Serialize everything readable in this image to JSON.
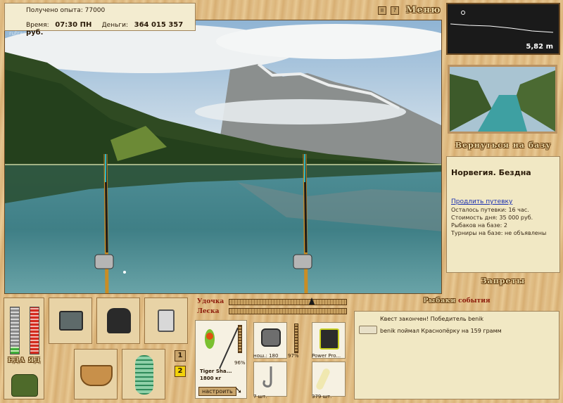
{
  "header": {
    "experience_label": "Получено опыта:",
    "experience_value": "77000",
    "time_label": "Время:",
    "time_value": "07:30 ПН",
    "money_label": "Деньги:",
    "money_value": "364 015 357 руб.",
    "watermark": "rutracker.ru",
    "menu_label": "Меню",
    "pause_label": "II",
    "help_label": "?"
  },
  "depth": {
    "value": "5,82 m"
  },
  "location": {
    "return_label": "Вернуться на базу",
    "name": "Норвегия. Бездна",
    "extend_link": "Продлить путевку",
    "lines": [
      "Осталось путевки: 16 час.",
      "Стоимость дня: 35 000 руб.",
      "Рыбаков на базе: 2",
      "Турниры на базе: не объявлены"
    ],
    "bans_label": "Запреты"
  },
  "status": {
    "food_label": "ЕДА",
    "sleep_label": "ЯД",
    "food_level": 0.15,
    "sleep_level": 1.0
  },
  "pages": {
    "page1": "1",
    "page2": "2"
  },
  "tackle": {
    "rod_label": "Удочка",
    "line_label": "Леска",
    "rod_tension": 0.68,
    "rod_name": "Tiger Sha...",
    "rod_weight": "1800 кг",
    "rod_pct": "96%",
    "reel_name": "нош.: 180",
    "reel_pct": "97%",
    "line_name": "Power Pro...",
    "hook_count": "7 шт.",
    "bait_count": "379 шт.",
    "setup_label": "настроить"
  },
  "messages": {
    "title_part1": "Рыбаки",
    "title_part2": "события",
    "items": [
      "Квест закончен! Победитель benik",
      "benik поймал Краснопёрку на 159 грамм"
    ]
  },
  "colors": {
    "food": "#3fae3a",
    "sleep": "#d42a1e",
    "accent": "#8b1a0a"
  }
}
